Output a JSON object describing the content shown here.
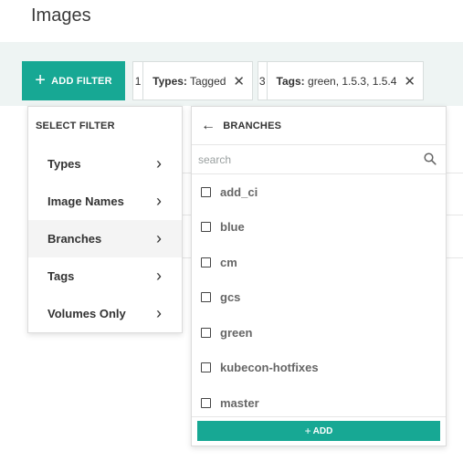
{
  "page": {
    "title": "Images"
  },
  "toolbar": {
    "add_filter_label": "ADD FILTER",
    "add_filter_icon": "+"
  },
  "active_filters": [
    {
      "index": "1",
      "label": "Types:",
      "value": "Tagged",
      "remove": "✕"
    },
    {
      "index": "3",
      "label": "Tags:",
      "value": "green, 1.5.3, 1.5.4",
      "remove": "✕"
    }
  ],
  "select_filter": {
    "title": "SELECT FILTER",
    "items": [
      {
        "label": "Types"
      },
      {
        "label": "Image Names"
      },
      {
        "label": "Branches"
      },
      {
        "label": "Tags"
      },
      {
        "label": "Volumes Only"
      }
    ],
    "chevron": "›"
  },
  "branches_panel": {
    "back_icon": "←",
    "title": "BRANCHES",
    "search_placeholder": "search",
    "items": [
      "add_ci",
      "blue",
      "cm",
      "gcs",
      "green",
      "kubecon-hotfixes",
      "master"
    ],
    "add_label": "ADD",
    "add_icon": "+"
  },
  "colors": {
    "accent": "#17a894",
    "band": "#eef4f3"
  }
}
